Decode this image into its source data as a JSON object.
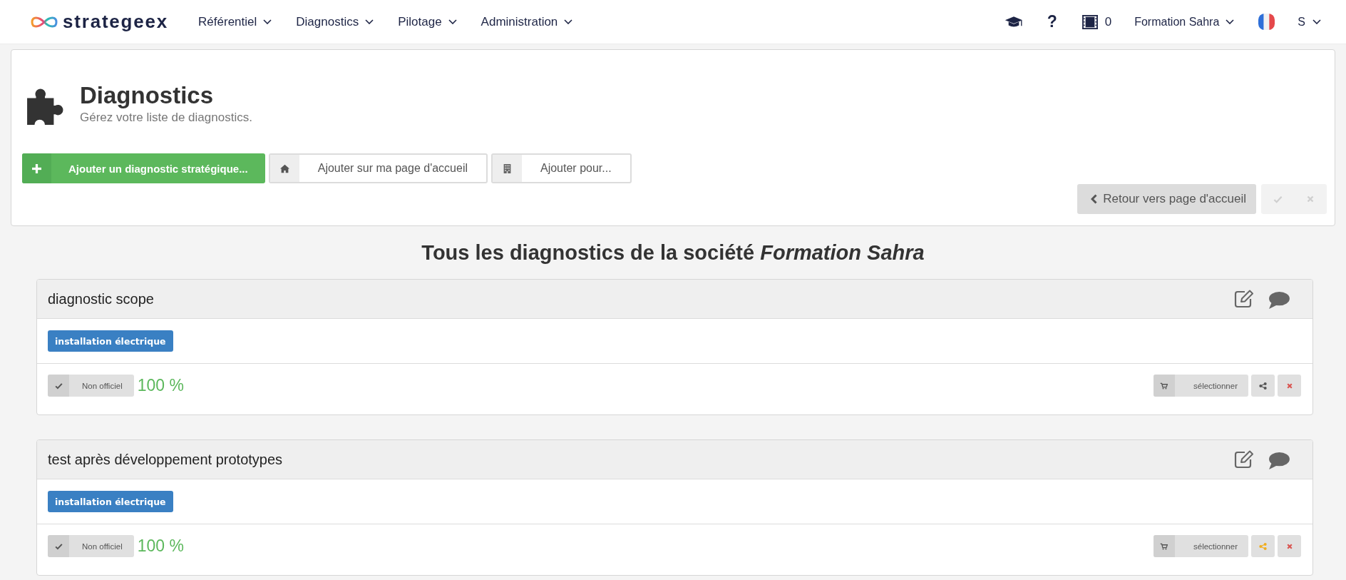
{
  "navbar": {
    "logo": "strategeex",
    "menu": [
      {
        "label": "Référentiel"
      },
      {
        "label": "Diagnostics"
      },
      {
        "label": "Pilotage"
      },
      {
        "label": "Administration"
      }
    ],
    "help_label": "?",
    "counter": "0",
    "company": "Formation Sahra",
    "user": "S"
  },
  "header": {
    "title": "Diagnostics",
    "subtitle": "Gérez votre liste de diagnostics.",
    "actions": [
      {
        "kind": "add",
        "label": "Ajouter un diagnostic stratégique..."
      },
      {
        "kind": "home",
        "label": "Ajouter sur ma page d'accueil"
      },
      {
        "kind": "building",
        "label": "Ajouter pour..."
      }
    ],
    "back_label": "Retour vers page d'accueil",
    "confirm": {
      "disabled": true
    },
    "cancel": {
      "disabled": true
    }
  },
  "heading": "Tous les diagnostics de la société *Formation Sahra*",
  "diagnostics": [
    {
      "title": "diagnostic scope",
      "tags": [
        "installation électrique"
      ],
      "status": "Non officiel",
      "score": "100 %",
      "select_label": "sélectionner",
      "shared": false
    },
    {
      "title": "test après développement prototypes",
      "tags": [
        "installation électrique"
      ],
      "status": "Non officiel",
      "score": "100 %",
      "select_label": "sélectionner",
      "shared": true
    }
  ]
}
